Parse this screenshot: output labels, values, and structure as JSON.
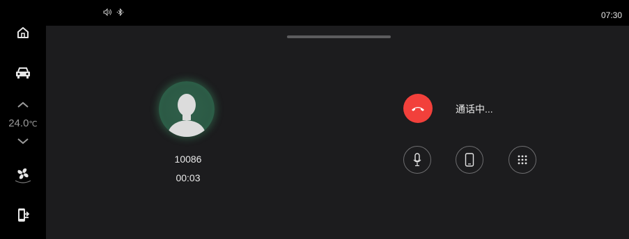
{
  "sidebar": {
    "temperature": {
      "value": "24.0",
      "unit": "℃"
    },
    "icons": [
      "home-icon",
      "car-icon",
      "chevron-up-icon",
      "chevron-down-icon",
      "fan-icon",
      "phone-transfer-icon"
    ]
  },
  "statusbar": {
    "time": "07:30",
    "icons": [
      "volume-icon",
      "bluetooth-icon"
    ]
  },
  "call": {
    "number": "10086",
    "duration": "00:03",
    "status": "通话中..."
  },
  "colors": {
    "hangup": "#f2403b",
    "panel": "#1c1c1e",
    "avatar_glow": "#2a6a4f"
  }
}
